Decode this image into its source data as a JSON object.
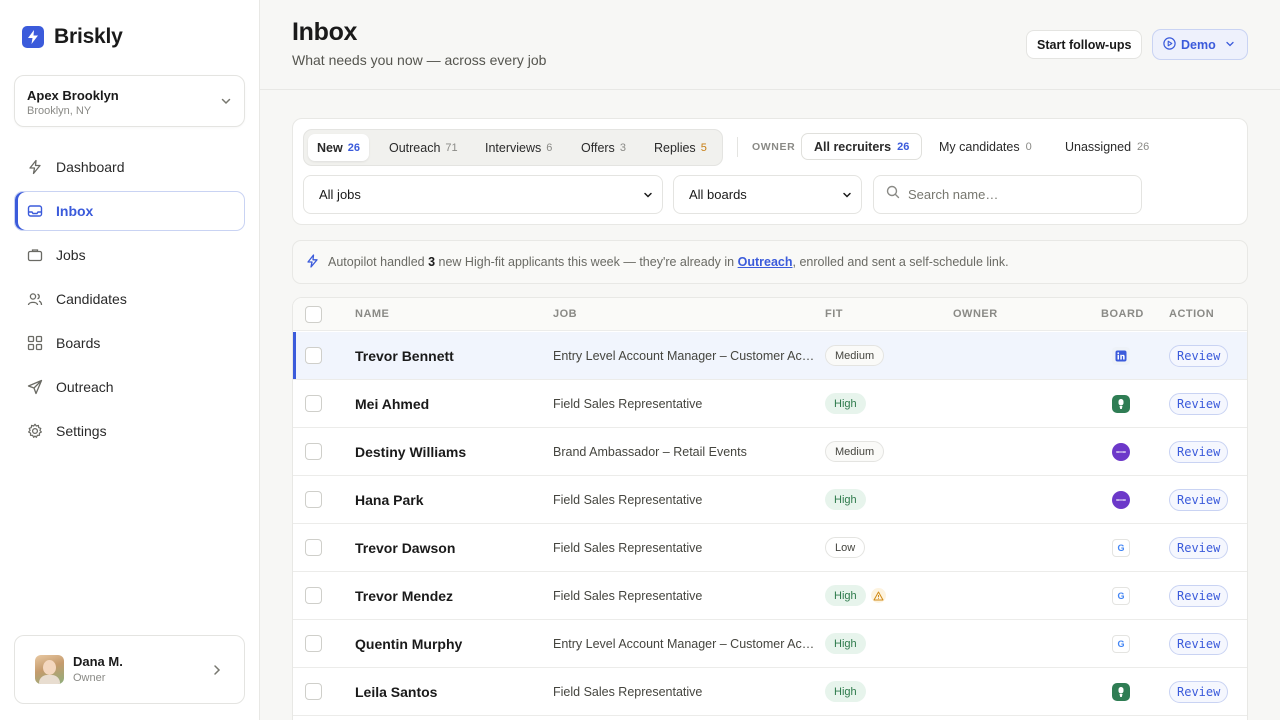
{
  "brand": {
    "name": "Briskly"
  },
  "workspace": {
    "name": "Apex Brooklyn",
    "location": "Brooklyn, NY"
  },
  "nav": [
    {
      "label": "Dashboard",
      "icon": "bolt-icon",
      "active": false
    },
    {
      "label": "Inbox",
      "icon": "inbox-icon",
      "active": true
    },
    {
      "label": "Jobs",
      "icon": "briefcase-icon",
      "active": false
    },
    {
      "label": "Candidates",
      "icon": "users-icon",
      "active": false
    },
    {
      "label": "Boards",
      "icon": "grid-icon",
      "active": false
    },
    {
      "label": "Outreach",
      "icon": "send-icon",
      "active": false
    },
    {
      "label": "Settings",
      "icon": "gear-icon",
      "active": false
    }
  ],
  "user": {
    "name": "Dana M.",
    "role": "Owner"
  },
  "header": {
    "title": "Inbox",
    "subtitle": "What needs you now — across every job",
    "follow_label": "Start follow-ups",
    "demo_label": "Demo"
  },
  "tabs": [
    {
      "label": "New",
      "count": "26",
      "active": true
    },
    {
      "label": "Outreach",
      "count": "71",
      "active": false
    },
    {
      "label": "Interviews",
      "count": "6",
      "active": false
    },
    {
      "label": "Offers",
      "count": "3",
      "active": false
    },
    {
      "label": "Replies",
      "count": "5",
      "active": false,
      "accent": "#c77d12"
    }
  ],
  "owner_filter": {
    "label": "OWNER",
    "options": [
      {
        "label": "All recruiters",
        "count": "26",
        "active": true
      },
      {
        "label": "My candidates",
        "count": "0",
        "active": false
      },
      {
        "label": "Unassigned",
        "count": "26",
        "active": false
      }
    ]
  },
  "filters": {
    "jobs_value": "All jobs",
    "boards_value": "All boards",
    "search_placeholder": "Search name…"
  },
  "banner": {
    "prefix": "Autopilot handled",
    "count": "3",
    "middle": "new High-fit applicants this week — they're already in",
    "link": "Outreach",
    "suffix": ", enrolled and sent a self-schedule link."
  },
  "table": {
    "columns": [
      "NAME",
      "JOB",
      "FIT",
      "OWNER",
      "BOARD",
      "ACTION"
    ],
    "action_label": "Review",
    "rows": [
      {
        "name": "Trevor Bennett",
        "job": "Entry Level Account Manager – Customer Acquisition",
        "fit": "Medium",
        "board": "linkedin",
        "highlight": true,
        "warning": false
      },
      {
        "name": "Mei Ahmed",
        "job": "Field Sales Representative",
        "fit": "High",
        "board": "jobcase",
        "highlight": false,
        "warning": false
      },
      {
        "name": "Destiny Williams",
        "job": "Brand Ambassador – Retail Events",
        "fit": "Medium",
        "board": "hoodie",
        "highlight": false,
        "warning": false
      },
      {
        "name": "Hana Park",
        "job": "Field Sales Representative",
        "fit": "High",
        "board": "hoodie",
        "highlight": false,
        "warning": false
      },
      {
        "name": "Trevor Dawson",
        "job": "Field Sales Representative",
        "fit": "Low",
        "board": "google",
        "highlight": false,
        "warning": false
      },
      {
        "name": "Trevor Mendez",
        "job": "Field Sales Representative",
        "fit": "High",
        "board": "google",
        "highlight": false,
        "warning": true
      },
      {
        "name": "Quentin Murphy",
        "job": "Entry Level Account Manager – Customer Acquisition",
        "fit": "High",
        "board": "google",
        "highlight": false,
        "warning": false
      },
      {
        "name": "Leila Santos",
        "job": "Field Sales Representative",
        "fit": "High",
        "board": "jobcase",
        "highlight": false,
        "warning": false
      }
    ]
  },
  "colors": {
    "accent": "#3b5bdb",
    "high": "#2d7a4b",
    "warning": "#d08a16"
  }
}
